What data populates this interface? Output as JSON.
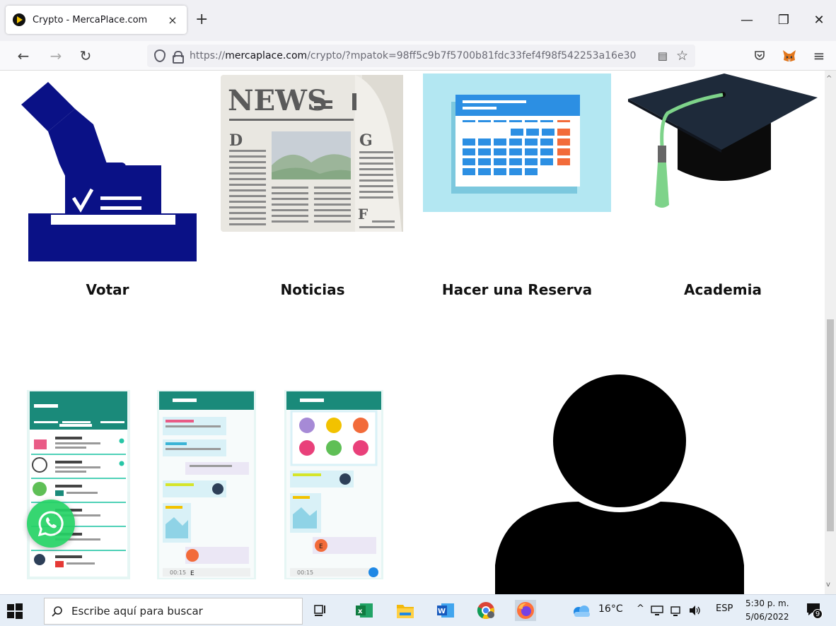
{
  "browser": {
    "tab_title": "Crypto - MercaPlace.com",
    "tab_close": "×",
    "new_tab": "+",
    "window_controls": {
      "minimize": "—",
      "restore": "❐",
      "close": "✕"
    },
    "nav": {
      "back": "←",
      "forward": "→",
      "reload": "↻",
      "menu": "≡"
    },
    "url_prefix": "https://",
    "url_host": "mercaplace.com",
    "url_path": "/crypto/?mpatok=98ff5c9b7f5700b81fdc33fef4f98f542253a16e30",
    "reader_icon": "▤",
    "bookmark_icon": "☆"
  },
  "cards": [
    {
      "label": "Votar",
      "icon": "ballot-box-icon"
    },
    {
      "label": "Noticias",
      "icon": "newspaper-icon"
    },
    {
      "label": "Hacer una Reserva",
      "icon": "calendar-icon"
    },
    {
      "label": "Academia",
      "icon": "graduation-cap-icon"
    }
  ],
  "colors": {
    "vote_blue": "#0a1186",
    "calendar_bg": "#b3e7f2",
    "calendar_blue": "#2c8fe3",
    "calendar_orange": "#f26b3a",
    "cap_dark": "#1e2a3a",
    "tassel_green": "#7ed38a",
    "chat_teal": "#1a8a7a",
    "whatsapp_green": "#25d366"
  },
  "chat_screens": {
    "timer_1": "00:15",
    "timer_2": "00:15",
    "timer_3": "00:15",
    "badge_letter": "E"
  },
  "taskbar": {
    "search_placeholder": "Escribe aquí para buscar",
    "weather": "16°C",
    "lang": "ESP",
    "time": "5:30 p. m.",
    "date": "5/06/2022",
    "notif_count": "9"
  }
}
